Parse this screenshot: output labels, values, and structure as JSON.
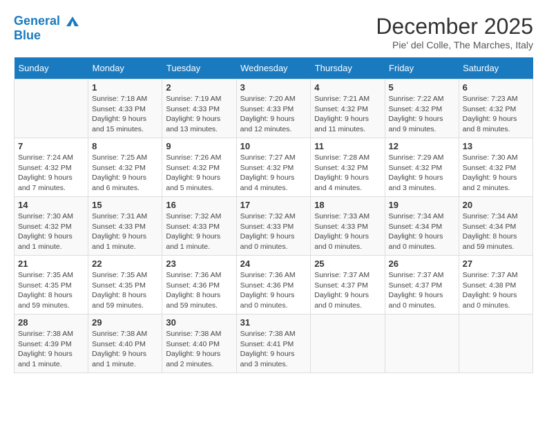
{
  "header": {
    "logo_line1": "General",
    "logo_line2": "Blue",
    "month_title": "December 2025",
    "location": "Pie' del Colle, The Marches, Italy"
  },
  "days_of_week": [
    "Sunday",
    "Monday",
    "Tuesday",
    "Wednesday",
    "Thursday",
    "Friday",
    "Saturday"
  ],
  "weeks": [
    [
      {
        "day": "",
        "info": ""
      },
      {
        "day": "1",
        "info": "Sunrise: 7:18 AM\nSunset: 4:33 PM\nDaylight: 9 hours\nand 15 minutes."
      },
      {
        "day": "2",
        "info": "Sunrise: 7:19 AM\nSunset: 4:33 PM\nDaylight: 9 hours\nand 13 minutes."
      },
      {
        "day": "3",
        "info": "Sunrise: 7:20 AM\nSunset: 4:33 PM\nDaylight: 9 hours\nand 12 minutes."
      },
      {
        "day": "4",
        "info": "Sunrise: 7:21 AM\nSunset: 4:32 PM\nDaylight: 9 hours\nand 11 minutes."
      },
      {
        "day": "5",
        "info": "Sunrise: 7:22 AM\nSunset: 4:32 PM\nDaylight: 9 hours\nand 9 minutes."
      },
      {
        "day": "6",
        "info": "Sunrise: 7:23 AM\nSunset: 4:32 PM\nDaylight: 9 hours\nand 8 minutes."
      }
    ],
    [
      {
        "day": "7",
        "info": "Sunrise: 7:24 AM\nSunset: 4:32 PM\nDaylight: 9 hours\nand 7 minutes."
      },
      {
        "day": "8",
        "info": "Sunrise: 7:25 AM\nSunset: 4:32 PM\nDaylight: 9 hours\nand 6 minutes."
      },
      {
        "day": "9",
        "info": "Sunrise: 7:26 AM\nSunset: 4:32 PM\nDaylight: 9 hours\nand 5 minutes."
      },
      {
        "day": "10",
        "info": "Sunrise: 7:27 AM\nSunset: 4:32 PM\nDaylight: 9 hours\nand 4 minutes."
      },
      {
        "day": "11",
        "info": "Sunrise: 7:28 AM\nSunset: 4:32 PM\nDaylight: 9 hours\nand 4 minutes."
      },
      {
        "day": "12",
        "info": "Sunrise: 7:29 AM\nSunset: 4:32 PM\nDaylight: 9 hours\nand 3 minutes."
      },
      {
        "day": "13",
        "info": "Sunrise: 7:30 AM\nSunset: 4:32 PM\nDaylight: 9 hours\nand 2 minutes."
      }
    ],
    [
      {
        "day": "14",
        "info": "Sunrise: 7:30 AM\nSunset: 4:32 PM\nDaylight: 9 hours\nand 1 minute."
      },
      {
        "day": "15",
        "info": "Sunrise: 7:31 AM\nSunset: 4:33 PM\nDaylight: 9 hours\nand 1 minute."
      },
      {
        "day": "16",
        "info": "Sunrise: 7:32 AM\nSunset: 4:33 PM\nDaylight: 9 hours\nand 1 minute."
      },
      {
        "day": "17",
        "info": "Sunrise: 7:32 AM\nSunset: 4:33 PM\nDaylight: 9 hours\nand 0 minutes."
      },
      {
        "day": "18",
        "info": "Sunrise: 7:33 AM\nSunset: 4:33 PM\nDaylight: 9 hours\nand 0 minutes."
      },
      {
        "day": "19",
        "info": "Sunrise: 7:34 AM\nSunset: 4:34 PM\nDaylight: 9 hours\nand 0 minutes."
      },
      {
        "day": "20",
        "info": "Sunrise: 7:34 AM\nSunset: 4:34 PM\nDaylight: 8 hours\nand 59 minutes."
      }
    ],
    [
      {
        "day": "21",
        "info": "Sunrise: 7:35 AM\nSunset: 4:35 PM\nDaylight: 8 hours\nand 59 minutes."
      },
      {
        "day": "22",
        "info": "Sunrise: 7:35 AM\nSunset: 4:35 PM\nDaylight: 8 hours\nand 59 minutes."
      },
      {
        "day": "23",
        "info": "Sunrise: 7:36 AM\nSunset: 4:36 PM\nDaylight: 8 hours\nand 59 minutes."
      },
      {
        "day": "24",
        "info": "Sunrise: 7:36 AM\nSunset: 4:36 PM\nDaylight: 9 hours\nand 0 minutes."
      },
      {
        "day": "25",
        "info": "Sunrise: 7:37 AM\nSunset: 4:37 PM\nDaylight: 9 hours\nand 0 minutes."
      },
      {
        "day": "26",
        "info": "Sunrise: 7:37 AM\nSunset: 4:37 PM\nDaylight: 9 hours\nand 0 minutes."
      },
      {
        "day": "27",
        "info": "Sunrise: 7:37 AM\nSunset: 4:38 PM\nDaylight: 9 hours\nand 0 minutes."
      }
    ],
    [
      {
        "day": "28",
        "info": "Sunrise: 7:38 AM\nSunset: 4:39 PM\nDaylight: 9 hours\nand 1 minute."
      },
      {
        "day": "29",
        "info": "Sunrise: 7:38 AM\nSunset: 4:40 PM\nDaylight: 9 hours\nand 1 minute."
      },
      {
        "day": "30",
        "info": "Sunrise: 7:38 AM\nSunset: 4:40 PM\nDaylight: 9 hours\nand 2 minutes."
      },
      {
        "day": "31",
        "info": "Sunrise: 7:38 AM\nSunset: 4:41 PM\nDaylight: 9 hours\nand 3 minutes."
      },
      {
        "day": "",
        "info": ""
      },
      {
        "day": "",
        "info": ""
      },
      {
        "day": "",
        "info": ""
      }
    ]
  ]
}
